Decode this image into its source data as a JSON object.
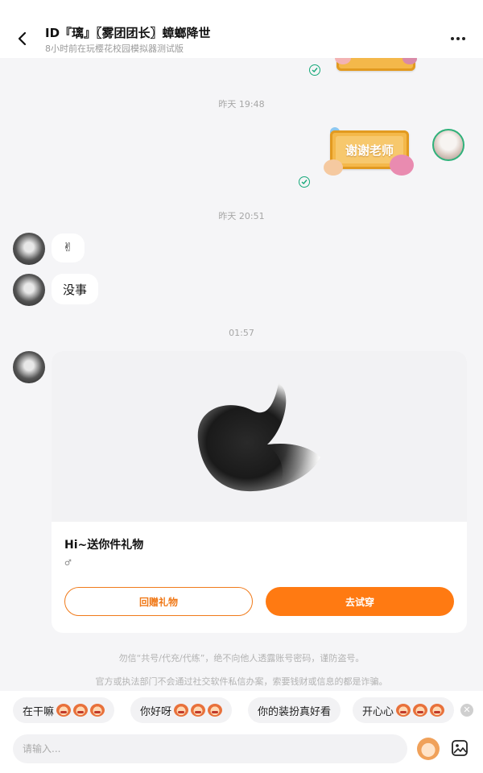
{
  "header": {
    "title": "ID『璃』〖雾团团长〗蟑螂降世",
    "subtitle": "8小时前在玩樱花校园模拟器测试版"
  },
  "messages": {
    "ts_1": "昨天 19:48",
    "sticker_text": "谢谢老师",
    "ts_2": "昨天 20:51",
    "msg_1": "✌",
    "msg_2": "没事",
    "ts_3": "01:57"
  },
  "gift_card": {
    "title": "Hi~送你件礼物",
    "note": "♂",
    "return_gift_label": "回赠礼物",
    "try_on_label": "去试穿"
  },
  "notices": [
    "勿信“共号/代充/代练”，绝不向他人透露账号密码，谨防盗号。",
    "官方或执法部门不会通过社交软件私信办案，索要钱财或信息的都是诈骗。"
  ],
  "quick_replies": [
    "在干嘛",
    "你好呀",
    "你的装扮真好看",
    "开心心"
  ],
  "input": {
    "placeholder": "请输入..."
  },
  "colors": {
    "accent": "#ff7a12",
    "read_check": "#16a97a",
    "background": "#f5f5f7"
  }
}
